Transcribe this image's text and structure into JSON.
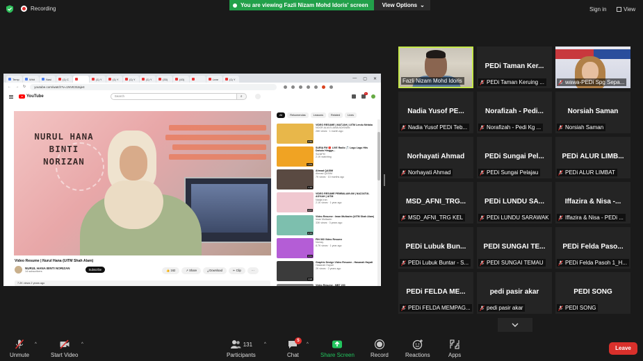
{
  "topbar": {
    "recording_label": "Recording",
    "viewing_text": "You are viewing Fazli Nizam Mohd Idoris' screen",
    "view_options_label": "View Options",
    "signin_label": "Sign in",
    "view_label": "View"
  },
  "browser": {
    "tabs": [
      "Temp",
      "Whit",
      "Nasi",
      "(1) C",
      "",
      "(1) Y",
      "(1) Y",
      "(1) Y",
      "(1) Y",
      "(33)",
      "(43)",
      "",
      "Lear",
      "(1) Y"
    ],
    "url": "youtube.com/watch?v=1NVE3tJaje4"
  },
  "youtube": {
    "logo": "YouTube",
    "search_placeholder": "Search",
    "video_title": "Video Resume | Nurul Hana (UiTM Shah Alam)",
    "poster_name_lines": [
      "NURUL HANA",
      "BINTI",
      "NORIZAN"
    ],
    "channel_name": "NURUL HANA BINTI NORIZAN",
    "channel_subs": "14 subscribers",
    "subscribe_label": "Subscribe",
    "like_count": "162",
    "share_label": "Share",
    "download_label": "Download",
    "clip_label": "Clip",
    "views_line": "7.2K views  2 years ago",
    "chips": [
      "All",
      "Rekomendas",
      "Leasons",
      "Related",
      "Lives"
    ],
    "recommendations": [
      {
        "title": "VIDEO RESUME | MATJAH | UiTM Lendu Melaka",
        "channel": "NOOR ALIA ELIANA ADISNAN",
        "meta": "26K views · 1 month ago",
        "duration": "2:59",
        "color": "#e8b74a"
      },
      {
        "title": "SURIA FM 🔴 LIVE Radio 🎵 Lagu Lagu Hits Dahulu Hingga...",
        "channel": "SuriaFM",
        "meta": "2.1K watching",
        "duration": "LIVE",
        "color": "#f0a323"
      },
      {
        "title": "Ahmad QASIM",
        "channel": "Ahmad QASIM",
        "meta": "7K views · 10 months ago",
        "duration": "1:48",
        "color": "#5a4a42"
      },
      {
        "title": "VIDEO RESUME PEMBALAM AM | NAZJATUL ASYIAH | UiTM",
        "channel": "Nadja Iran",
        "meta": "2.1K views · 1 year ago",
        "duration": "2:07",
        "color": "#f0c8d0"
      },
      {
        "title": "Video Resume : Iman Multazim (UiTM Shah Alam)",
        "channel": "Iman Multazim",
        "meta": "33K views · 3 years ago",
        "duration": "2:19",
        "color": "#7dbfae"
      },
      {
        "title": "FIN 360 Video Resume",
        "channel": "Nomzy",
        "meta": "8.7K views · 1 year ago",
        "duration": "4:11",
        "color": "#b45dd6"
      },
      {
        "title": "Graphic Design Video Resume - Hasanah Hayati",
        "channel": "Hasanah Hayati",
        "meta": "2K views · 2 years ago",
        "duration": "3:08",
        "color": "#3b3b3b"
      },
      {
        "title": "Video Resume - MBT 200",
        "channel": "",
        "meta": "",
        "duration": "",
        "color": "#888888"
      }
    ]
  },
  "participants": [
    {
      "tile_name": "",
      "label": "Fazli Nizam Mohd Idoris",
      "muted": false,
      "video": "man"
    },
    {
      "tile_name": "PEDi Taman Ker...",
      "label": "PEDi Taman Keruing ...",
      "muted": true,
      "video": ""
    },
    {
      "tile_name": "",
      "label": "wawa-PEDi Spg Sepa...",
      "muted": true,
      "video": "woman"
    },
    {
      "tile_name": "Nadia Yusof PE...",
      "label": "Nadia Yusof PEDi Teb...",
      "muted": true,
      "video": ""
    },
    {
      "tile_name": "Norafizah - Pedi...",
      "label": "Norafizah - Pedi Kg ...",
      "muted": true,
      "video": ""
    },
    {
      "tile_name": "Norsiah Saman",
      "label": "Norsiah Saman",
      "muted": true,
      "video": ""
    },
    {
      "tile_name": "Norhayati Ahmad",
      "label": "Norhayati Ahmad",
      "muted": true,
      "video": ""
    },
    {
      "tile_name": "PEDi Sungai Pel...",
      "label": "PEDi Sungai Pelajau",
      "muted": true,
      "video": ""
    },
    {
      "tile_name": "PEDi ALUR LIMB...",
      "label": "PEDi ALUR LIMBAT",
      "muted": true,
      "video": ""
    },
    {
      "tile_name": "MSD_AFNI_TRG...",
      "label": "MSD_AFNI_TRG KEL",
      "muted": true,
      "video": ""
    },
    {
      "tile_name": "PEDi LUNDU SA...",
      "label": "PEDi LUNDU SARAWAK",
      "muted": true,
      "video": ""
    },
    {
      "tile_name": "Iffazira & Nisa -...",
      "label": "Iffazira & Nisa - PEDi ...",
      "muted": true,
      "video": ""
    },
    {
      "tile_name": "PEDi Lubuk Bun...",
      "label": "PEDi Lubuk Buntar - S...",
      "muted": true,
      "video": ""
    },
    {
      "tile_name": "PEDI SUNGAI TE...",
      "label": "PEDI SUNGAI TEMAU",
      "muted": true,
      "video": ""
    },
    {
      "tile_name": "PEDi Felda Paso...",
      "label": "PEDi Felda Pasoh 1_H...",
      "muted": true,
      "video": ""
    },
    {
      "tile_name": "PEDi FELDA ME...",
      "label": "PEDi FELDA MEMPAG...",
      "muted": true,
      "video": ""
    },
    {
      "tile_name": "pedi pasir akar",
      "label": "pedi pasir akar",
      "muted": true,
      "video": ""
    },
    {
      "tile_name": "PEDI SONG",
      "label": "PEDI SONG",
      "muted": true,
      "video": ""
    }
  ],
  "toolbar": {
    "unmute_label": "Unmute",
    "start_video_label": "Start Video",
    "participants_label": "Participants",
    "participants_count": "131",
    "chat_label": "Chat",
    "chat_badge": "5",
    "share_screen_label": "Share Screen",
    "record_label": "Record",
    "reactions_label": "Reactions",
    "apps_label": "Apps",
    "leave_label": "Leave"
  },
  "colors": {
    "accent_green": "#22a04a",
    "share_green": "#22c55e",
    "leave_red": "#d9302b",
    "mute_red": "#e0312f",
    "active_speaker_border": "#c5e84a"
  }
}
